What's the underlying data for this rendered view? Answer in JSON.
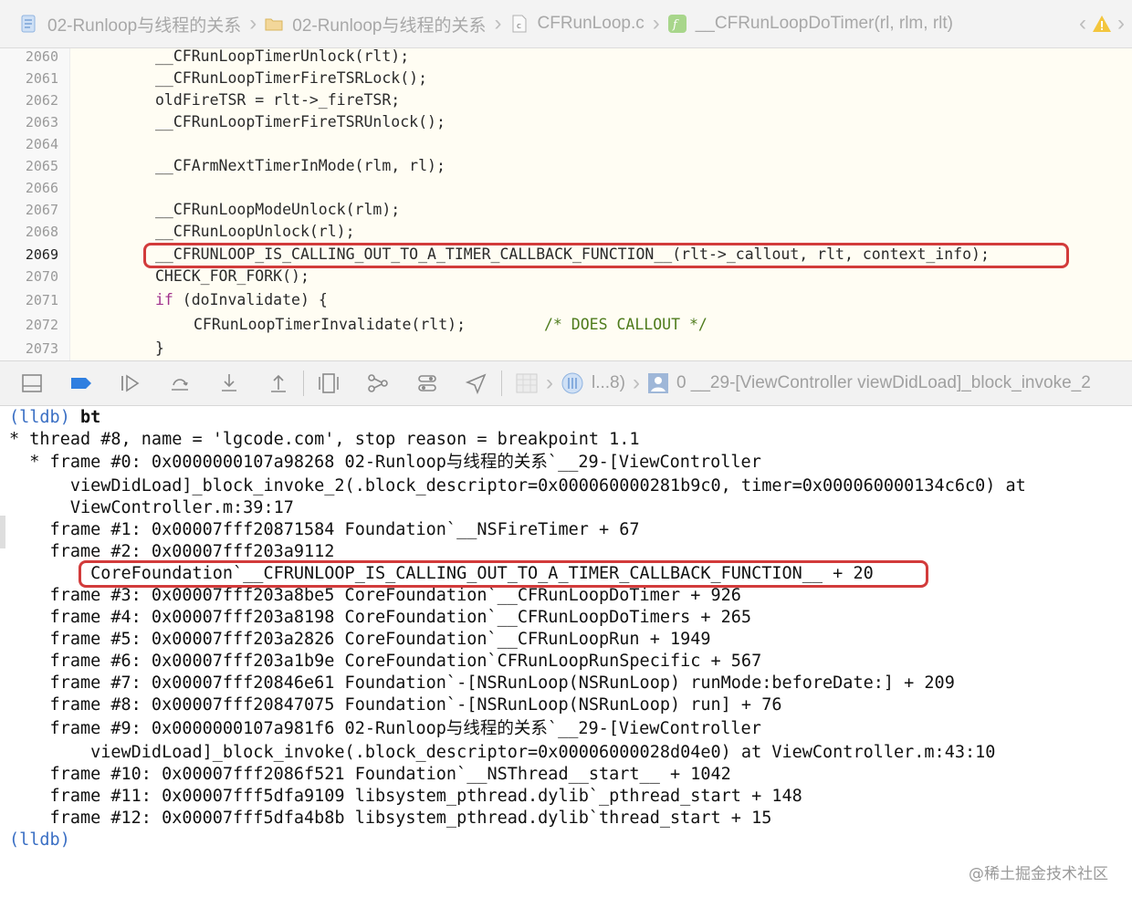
{
  "breadcrumb": {
    "items": [
      "02-Runloop与线程的关系",
      "02-Runloop与线程的关系",
      "CFRunLoop.c",
      "__CFRunLoopDoTimer(rl, rlm, rlt)"
    ],
    "icons": [
      "project-icon",
      "folder-icon",
      "c-file-icon",
      "function-icon"
    ]
  },
  "editor": {
    "lines": [
      {
        "num": "2060",
        "text": "__CFRunLoopTimerUnlock(rlt);"
      },
      {
        "num": "2061",
        "text": "__CFRunLoopTimerFireTSRLock();"
      },
      {
        "num": "2062",
        "text": "oldFireTSR = rlt->_fireTSR;"
      },
      {
        "num": "2063",
        "text": "__CFRunLoopTimerFireTSRUnlock();"
      },
      {
        "num": "2064",
        "text": ""
      },
      {
        "num": "2065",
        "text": "__CFArmNextTimerInMode(rlm, rl);"
      },
      {
        "num": "2066",
        "text": ""
      },
      {
        "num": "2067",
        "text": "__CFRunLoopModeUnlock(rlm);"
      },
      {
        "num": "2068",
        "text": "__CFRunLoopUnlock(rl);"
      },
      {
        "num": "2069",
        "text": "__CFRUNLOOP_IS_CALLING_OUT_TO_A_TIMER_CALLBACK_FUNCTION__(rlt->_callout, rlt, context_info);"
      },
      {
        "num": "2070",
        "text": "CHECK_FOR_FORK();"
      },
      {
        "num": "2071",
        "kw": "if",
        "text": " (doInvalidate) {"
      },
      {
        "num": "2072",
        "text": "CFRunLoopTimerInvalidate(rlt);",
        "comment": "/* DOES CALLOUT */"
      },
      {
        "num": "2073",
        "text": "}"
      }
    ],
    "current_line": "2069"
  },
  "debugbar": {
    "thread_label": "l...8)",
    "frame_label": "0 __29-[ViewController viewDidLoad]_block_invoke_2"
  },
  "console": {
    "prompt": "(lldb)",
    "command": "bt",
    "lines": [
      "* thread #8, name = 'lgcode.com', stop reason = breakpoint 1.1",
      "  * frame #0: 0x0000000107a98268 02-Runloop与线程的关系`__29-[ViewController",
      "      viewDidLoad]_block_invoke_2(.block_descriptor=0x000060000281b9c0, timer=0x000060000134c6c0) at",
      "      ViewController.m:39:17",
      "    frame #1: 0x00007fff20871584 Foundation`__NSFireTimer + 67",
      "    frame #2: 0x00007fff203a9112",
      "        CoreFoundation`__CFRUNLOOP_IS_CALLING_OUT_TO_A_TIMER_CALLBACK_FUNCTION__ + 20",
      "    frame #3: 0x00007fff203a8be5 CoreFoundation`__CFRunLoopDoTimer + 926",
      "    frame #4: 0x00007fff203a8198 CoreFoundation`__CFRunLoopDoTimers + 265",
      "    frame #5: 0x00007fff203a2826 CoreFoundation`__CFRunLoopRun + 1949",
      "    frame #6: 0x00007fff203a1b9e CoreFoundation`CFRunLoopRunSpecific + 567",
      "    frame #7: 0x00007fff20846e61 Foundation`-[NSRunLoop(NSRunLoop) runMode:beforeDate:] + 209",
      "    frame #8: 0x00007fff20847075 Foundation`-[NSRunLoop(NSRunLoop) run] + 76",
      "    frame #9: 0x0000000107a981f6 02-Runloop与线程的关系`__29-[ViewController",
      "        viewDidLoad]_block_invoke(.block_descriptor=0x00006000028d04e0) at ViewController.m:43:10",
      "    frame #10: 0x00007fff2086f521 Foundation`__NSThread__start__ + 1042",
      "    frame #11: 0x00007fff5dfa9109 libsystem_pthread.dylib`_pthread_start + 148",
      "    frame #12: 0x00007fff5dfa4b8b libsystem_pthread.dylib`thread_start + 15"
    ],
    "end_prompt": "(lldb)"
  },
  "watermark": "@稀土掘金技术社区",
  "colors": {
    "highlight": "#d23b3b",
    "prompt": "#3a6fc4",
    "keyword": "#a2328c",
    "comment": "#4e7b1c"
  }
}
